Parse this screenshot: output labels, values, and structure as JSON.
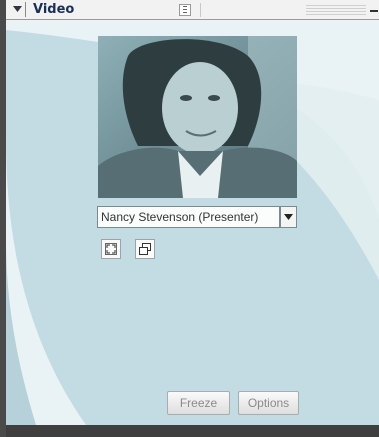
{
  "pod": {
    "title": "Video",
    "collapse_icon": "triangle-down-icon",
    "grip_icon": "grip-icon",
    "minimize_icon": "minimize-icon"
  },
  "video": {
    "presenter_selected": "Nancy Stevenson (Presenter)",
    "dropdown_icon": "chevron-down-icon",
    "fullscreen_icon": "fullscreen-icon",
    "popout_icon": "popout-window-icon"
  },
  "footer": {
    "freeze_label": "Freeze",
    "options_label": "Options"
  },
  "colors": {
    "title_text": "#1c2e57",
    "content_bg": "#e9f3f5",
    "accent_swoosh": "#b9d4dc",
    "frame_dark": "#3f3f3f"
  }
}
